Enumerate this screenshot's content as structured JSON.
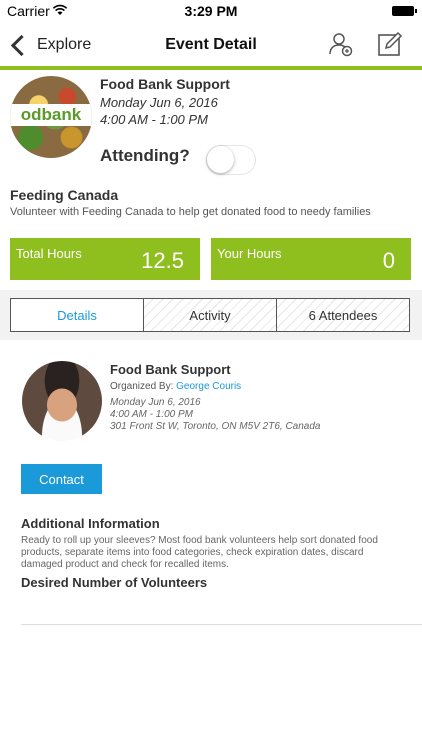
{
  "status_bar": {
    "carrier": "Carrier",
    "time": "3:29 PM"
  },
  "nav": {
    "back_label": "Explore",
    "title": "Event Detail"
  },
  "event": {
    "logo_text": "odbank",
    "title": "Food Bank Support",
    "date": "Monday Jun 6, 2016",
    "time": "4:00 AM - 1:00 PM",
    "attending_label": "Attending?",
    "attending": false
  },
  "organization": {
    "name": "Feeding Canada",
    "description": "Volunteer with Feeding Canada to help get donated food to needy families"
  },
  "hours": {
    "total_label": "Total Hours",
    "total_value": "12.5",
    "your_label": "Your Hours",
    "your_value": "0"
  },
  "tabs": [
    {
      "label": "Details",
      "active": true
    },
    {
      "label": "Activity",
      "active": false
    },
    {
      "label": "6 Attendees",
      "active": false
    }
  ],
  "details": {
    "title": "Food Bank Support",
    "organized_by_prefix": "Organized By:",
    "organizer": "George Couris",
    "date": "Monday Jun 6, 2016",
    "time": "4:00 AM - 1:00 PM",
    "address": "301 Front St W, Toronto, ON M5V 2T6, Canada",
    "contact_label": "Contact",
    "additional_info_heading": "Additional Information",
    "additional_info_body": "Ready to roll up your sleeves? Most food bank volunteers help sort donated food products, separate items into food categories, check expiration dates, discard damaged product and check for recalled items.",
    "desired_volunteers_heading": "Desired Number of Volunteers"
  },
  "colors": {
    "accent_green": "#8fbf1f",
    "link_blue": "#1a9ad8"
  },
  "icons": [
    "wifi-icon",
    "battery-icon",
    "back-chevron-icon",
    "add-user-icon",
    "edit-icon"
  ]
}
